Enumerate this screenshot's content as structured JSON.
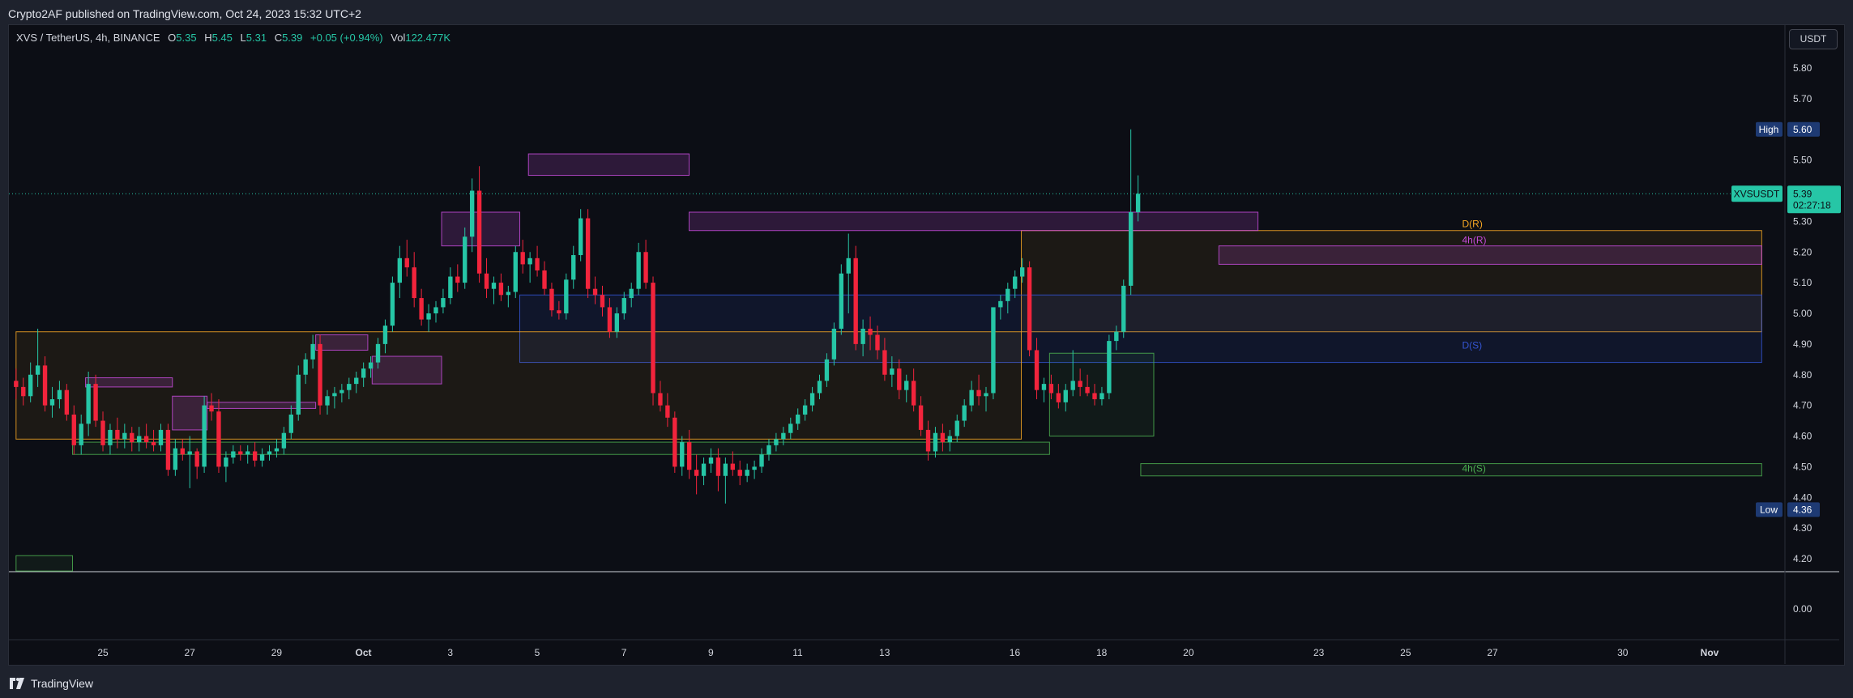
{
  "publisher_line": "Crypto2AF published on TradingView.com, Oct 24, 2023 15:32 UTC+2",
  "legend": {
    "symbol": "XVS / TetherUS, 4h, BINANCE",
    "open_label": "O",
    "open": "5.35",
    "high_label": "H",
    "high": "5.45",
    "low_label": "L",
    "low": "5.31",
    "close_label": "C",
    "close": "5.39",
    "change": "+0.05 (+0.94%)",
    "vol_label": "Vol",
    "vol": "122.477K"
  },
  "currency_button": "USDT",
  "footer_brand": "TradingView",
  "colors": {
    "up": "#26c6a6",
    "down": "#f2243c",
    "resistance_orange": "#f5a623",
    "support_blue": "#3454d1",
    "supply_purple": "#c64bdb",
    "demand_green": "#4caf50",
    "price_tag": "#26c6a6",
    "high_low_tag": "#1e3a73"
  },
  "chart_data": {
    "type": "candlestick",
    "symbol": "XVSUSDT",
    "timeframe": "4h",
    "ylim": [
      4.15,
      5.87
    ],
    "y_ticks": [
      5.8,
      5.7,
      5.6,
      5.5,
      5.4,
      5.3,
      5.2,
      5.1,
      5.0,
      4.9,
      4.8,
      4.7,
      4.6,
      4.5,
      4.4,
      4.3,
      4.2
    ],
    "y_tick_labels": [
      "5.80",
      "5.70",
      "",
      "5.50",
      "",
      "5.30",
      "5.20",
      "5.10",
      "5.00",
      "4.90",
      "4.80",
      "4.70",
      "4.60",
      "4.50",
      "4.40",
      "4.30",
      "4.20"
    ],
    "x_range_days": [
      22.9,
      32.8
    ],
    "x_ticks": [
      {
        "day": 25,
        "label": "25"
      },
      {
        "day": 27,
        "label": "27"
      },
      {
        "day": 29,
        "label": "29"
      },
      {
        "day": 31,
        "label": "Oct"
      },
      {
        "day": 33,
        "label": "3"
      },
      {
        "day": 35,
        "label": "5"
      },
      {
        "day": 37,
        "label": "7"
      },
      {
        "day": 39,
        "label": "9"
      },
      {
        "day": 41,
        "label": "11"
      },
      {
        "day": 43,
        "label": "13"
      },
      {
        "day": 46,
        "label": "16"
      },
      {
        "day": 48,
        "label": "18"
      },
      {
        "day": 50,
        "label": "20"
      },
      {
        "day": 53,
        "label": "23"
      },
      {
        "day": 55,
        "label": "25"
      },
      {
        "day": 57,
        "label": "27"
      },
      {
        "day": 60,
        "label": "30"
      },
      {
        "day": 62,
        "label": "Nov"
      }
    ],
    "candle_start_day": 23.0,
    "candle_step_days": 0.1667,
    "candles": [
      [
        4.78,
        4.82,
        4.72,
        4.76
      ],
      [
        4.76,
        4.79,
        4.7,
        4.73
      ],
      [
        4.73,
        4.84,
        4.71,
        4.8
      ],
      [
        4.8,
        4.95,
        4.76,
        4.83
      ],
      [
        4.83,
        4.86,
        4.68,
        4.7
      ],
      [
        4.7,
        4.76,
        4.66,
        4.72
      ],
      [
        4.72,
        4.78,
        4.69,
        4.75
      ],
      [
        4.75,
        4.77,
        4.65,
        4.67
      ],
      [
        4.67,
        4.7,
        4.54,
        4.57
      ],
      [
        4.57,
        4.67,
        4.54,
        4.64
      ],
      [
        4.64,
        4.81,
        4.6,
        4.77
      ],
      [
        4.77,
        4.8,
        4.63,
        4.65
      ],
      [
        4.65,
        4.68,
        4.55,
        4.57
      ],
      [
        4.57,
        4.64,
        4.54,
        4.62
      ],
      [
        4.62,
        4.66,
        4.56,
        4.59
      ],
      [
        4.59,
        4.64,
        4.56,
        4.61
      ],
      [
        4.61,
        4.63,
        4.55,
        4.58
      ],
      [
        4.58,
        4.63,
        4.55,
        4.6
      ],
      [
        4.6,
        4.64,
        4.56,
        4.58
      ],
      [
        4.58,
        4.62,
        4.55,
        4.57
      ],
      [
        4.57,
        4.64,
        4.55,
        4.62
      ],
      [
        4.62,
        4.64,
        4.47,
        4.49
      ],
      [
        4.49,
        4.59,
        4.47,
        4.56
      ],
      [
        4.56,
        4.59,
        4.52,
        4.54
      ],
      [
        4.54,
        4.6,
        4.43,
        4.55
      ],
      [
        4.55,
        4.56,
        4.46,
        4.5
      ],
      [
        4.5,
        4.73,
        4.48,
        4.7
      ],
      [
        4.7,
        4.74,
        4.65,
        4.68
      ],
      [
        4.68,
        4.72,
        4.48,
        4.5
      ],
      [
        4.5,
        4.55,
        4.45,
        4.53
      ],
      [
        4.53,
        4.57,
        4.51,
        4.55
      ],
      [
        4.55,
        4.57,
        4.52,
        4.54
      ],
      [
        4.54,
        4.57,
        4.51,
        4.55
      ],
      [
        4.55,
        4.58,
        4.5,
        4.52
      ],
      [
        4.52,
        4.56,
        4.5,
        4.54
      ],
      [
        4.54,
        4.57,
        4.52,
        4.55
      ],
      [
        4.55,
        4.59,
        4.53,
        4.56
      ],
      [
        4.56,
        4.63,
        4.54,
        4.61
      ],
      [
        4.61,
        4.7,
        4.59,
        4.67
      ],
      [
        4.67,
        4.83,
        4.65,
        4.8
      ],
      [
        4.8,
        4.87,
        4.77,
        4.85
      ],
      [
        4.85,
        4.93,
        4.82,
        4.9
      ],
      [
        4.9,
        4.93,
        4.67,
        4.7
      ],
      [
        4.7,
        4.75,
        4.67,
        4.73
      ],
      [
        4.73,
        4.76,
        4.69,
        4.74
      ],
      [
        4.74,
        4.77,
        4.71,
        4.75
      ],
      [
        4.75,
        4.79,
        4.72,
        4.77
      ],
      [
        4.77,
        4.81,
        4.74,
        4.79
      ],
      [
        4.79,
        4.84,
        4.76,
        4.82
      ],
      [
        4.82,
        4.86,
        4.79,
        4.84
      ],
      [
        4.84,
        4.92,
        4.82,
        4.9
      ],
      [
        4.9,
        4.98,
        4.87,
        4.96
      ],
      [
        4.96,
        5.12,
        4.94,
        5.1
      ],
      [
        5.1,
        5.22,
        5.05,
        5.18
      ],
      [
        5.18,
        5.24,
        5.12,
        5.15
      ],
      [
        5.15,
        5.2,
        5.02,
        5.05
      ],
      [
        5.05,
        5.08,
        4.96,
        4.98
      ],
      [
        4.98,
        5.03,
        4.94,
        5.0
      ],
      [
        5.0,
        5.04,
        4.97,
        5.02
      ],
      [
        5.02,
        5.08,
        5.0,
        5.05
      ],
      [
        5.05,
        5.15,
        5.03,
        5.12
      ],
      [
        5.12,
        5.16,
        5.07,
        5.1
      ],
      [
        5.1,
        5.28,
        5.08,
        5.25
      ],
      [
        5.25,
        5.44,
        5.2,
        5.4
      ],
      [
        5.4,
        5.48,
        5.1,
        5.13
      ],
      [
        5.13,
        5.18,
        5.05,
        5.08
      ],
      [
        5.08,
        5.12,
        5.03,
        5.1
      ],
      [
        5.1,
        5.13,
        5.04,
        5.06
      ],
      [
        5.06,
        5.09,
        5.02,
        5.07
      ],
      [
        5.07,
        5.22,
        5.05,
        5.2
      ],
      [
        5.2,
        5.24,
        5.13,
        5.16
      ],
      [
        5.16,
        5.2,
        5.1,
        5.18
      ],
      [
        5.18,
        5.22,
        5.12,
        5.14
      ],
      [
        5.14,
        5.17,
        5.06,
        5.08
      ],
      [
        5.08,
        5.1,
        4.99,
        5.01
      ],
      [
        5.01,
        5.04,
        4.98,
        5.0
      ],
      [
        5.0,
        5.13,
        4.98,
        5.11
      ],
      [
        5.11,
        5.22,
        5.08,
        5.19
      ],
      [
        5.19,
        5.34,
        5.17,
        5.31
      ],
      [
        5.31,
        5.34,
        5.05,
        5.08
      ],
      [
        5.08,
        5.12,
        5.03,
        5.06
      ],
      [
        5.06,
        5.09,
        4.99,
        5.02
      ],
      [
        5.02,
        5.05,
        4.92,
        4.94
      ],
      [
        4.94,
        5.02,
        4.92,
        5.0
      ],
      [
        5.0,
        5.07,
        4.98,
        5.05
      ],
      [
        5.05,
        5.1,
        5.02,
        5.08
      ],
      [
        5.08,
        5.23,
        5.06,
        5.2
      ],
      [
        5.2,
        5.24,
        5.08,
        5.1
      ],
      [
        5.1,
        5.12,
        4.7,
        4.74
      ],
      [
        4.74,
        4.78,
        4.68,
        4.7
      ],
      [
        4.7,
        4.74,
        4.63,
        4.66
      ],
      [
        4.66,
        4.68,
        4.48,
        4.5
      ],
      [
        4.5,
        4.6,
        4.47,
        4.58
      ],
      [
        4.58,
        4.62,
        4.46,
        4.49
      ],
      [
        4.49,
        4.54,
        4.41,
        4.47
      ],
      [
        4.47,
        4.53,
        4.44,
        4.51
      ],
      [
        4.51,
        4.56,
        4.48,
        4.53
      ],
      [
        4.53,
        4.56,
        4.42,
        4.47
      ],
      [
        4.47,
        4.53,
        4.38,
        4.51
      ],
      [
        4.51,
        4.55,
        4.47,
        4.49
      ],
      [
        4.49,
        4.52,
        4.44,
        4.47
      ],
      [
        4.47,
        4.51,
        4.45,
        4.49
      ],
      [
        4.49,
        4.52,
        4.46,
        4.5
      ],
      [
        4.5,
        4.56,
        4.48,
        4.54
      ],
      [
        4.54,
        4.59,
        4.52,
        4.57
      ],
      [
        4.57,
        4.61,
        4.55,
        4.59
      ],
      [
        4.59,
        4.63,
        4.57,
        4.61
      ],
      [
        4.61,
        4.66,
        4.59,
        4.64
      ],
      [
        4.64,
        4.69,
        4.62,
        4.67
      ],
      [
        4.67,
        4.72,
        4.65,
        4.7
      ],
      [
        4.7,
        4.76,
        4.68,
        4.74
      ],
      [
        4.74,
        4.8,
        4.72,
        4.78
      ],
      [
        4.78,
        4.87,
        4.76,
        4.85
      ],
      [
        4.85,
        4.97,
        4.83,
        4.95
      ],
      [
        4.95,
        5.16,
        4.93,
        5.13
      ],
      [
        5.13,
        5.26,
        5.0,
        5.18
      ],
      [
        5.18,
        5.22,
        4.88,
        4.9
      ],
      [
        4.9,
        4.98,
        4.86,
        4.95
      ],
      [
        4.95,
        4.99,
        4.88,
        4.93
      ],
      [
        4.93,
        4.96,
        4.85,
        4.88
      ],
      [
        4.88,
        4.92,
        4.78,
        4.8
      ],
      [
        4.8,
        4.86,
        4.76,
        4.82
      ],
      [
        4.82,
        4.85,
        4.72,
        4.75
      ],
      [
        4.75,
        4.8,
        4.71,
        4.78
      ],
      [
        4.78,
        4.82,
        4.68,
        4.7
      ],
      [
        4.7,
        4.73,
        4.6,
        4.62
      ],
      [
        4.62,
        4.65,
        4.52,
        4.55
      ],
      [
        4.55,
        4.63,
        4.53,
        4.61
      ],
      [
        4.61,
        4.64,
        4.55,
        4.58
      ],
      [
        4.58,
        4.62,
        4.55,
        4.6
      ],
      [
        4.6,
        4.67,
        4.58,
        4.65
      ],
      [
        4.65,
        4.72,
        4.63,
        4.7
      ],
      [
        4.7,
        4.78,
        4.68,
        4.75
      ],
      [
        4.75,
        4.8,
        4.7,
        4.73
      ],
      [
        4.73,
        4.76,
        4.68,
        4.74
      ],
      [
        4.74,
        4.98,
        4.72,
        5.02
      ],
      [
        5.02,
        5.06,
        4.98,
        5.04
      ],
      [
        5.04,
        5.1,
        5.0,
        5.08
      ],
      [
        5.08,
        5.14,
        5.05,
        5.12
      ],
      [
        5.12,
        5.18,
        5.1,
        5.15
      ],
      [
        5.15,
        5.17,
        4.86,
        4.88
      ],
      [
        4.88,
        4.92,
        4.72,
        4.75
      ],
      [
        4.75,
        4.79,
        4.71,
        4.77
      ],
      [
        4.77,
        4.8,
        4.72,
        4.74
      ],
      [
        4.74,
        4.77,
        4.69,
        4.71
      ],
      [
        4.71,
        4.77,
        4.68,
        4.75
      ],
      [
        4.75,
        4.88,
        4.73,
        4.78
      ],
      [
        4.78,
        4.82,
        4.73,
        4.76
      ],
      [
        4.76,
        4.8,
        4.73,
        4.74
      ],
      [
        4.74,
        4.77,
        4.7,
        4.72
      ],
      [
        4.72,
        4.76,
        4.7,
        4.74
      ],
      [
        4.74,
        4.93,
        4.72,
        4.91
      ],
      [
        4.91,
        4.96,
        4.88,
        4.94
      ],
      [
        4.94,
        5.11,
        4.92,
        5.09
      ],
      [
        5.09,
        5.6,
        5.06,
        5.33
      ],
      [
        5.33,
        5.45,
        5.3,
        5.39
      ]
    ],
    "zones": [
      {
        "name": "D(R)",
        "kind": "resistance",
        "color": "#f5a623",
        "y_top": 5.27,
        "y_bottom": 4.94,
        "x0": 46.15,
        "x1": 63.2,
        "label_x": 56.3
      },
      {
        "name": "4h(R)",
        "kind": "supply",
        "color": "#c64bdb",
        "y_top": 5.22,
        "y_bottom": 5.16,
        "x0": 50.7,
        "x1": 63.2,
        "label_x": 56.3
      },
      {
        "name": "D(S)",
        "kind": "support",
        "color": "#3454d1",
        "y_top": 5.06,
        "y_bottom": 4.84,
        "x0": 34.6,
        "x1": 63.2,
        "label_x": 56.3
      },
      {
        "name": "4h(S)",
        "kind": "demand",
        "color": "#4caf50",
        "y_top": 4.51,
        "y_bottom": 4.47,
        "x0": 48.9,
        "x1": 63.2,
        "label_x": 56.3
      },
      {
        "name": "",
        "kind": "resistance",
        "color": "#f5a623",
        "y_top": 4.94,
        "y_bottom": 4.59,
        "x0": 23.0,
        "x1": 46.15,
        "label_x": 0
      },
      {
        "name": "",
        "kind": "demand",
        "color": "#4caf50",
        "y_top": 4.58,
        "y_bottom": 4.54,
        "x0": 24.3,
        "x1": 46.8,
        "label_x": 0
      },
      {
        "name": "",
        "kind": "demand",
        "color": "#4caf50",
        "y_top": 4.87,
        "y_bottom": 4.6,
        "x0": 46.8,
        "x1": 49.2,
        "label_x": 0
      },
      {
        "name": "",
        "kind": "supply",
        "color": "#c64bdb",
        "y_top": 5.52,
        "y_bottom": 5.45,
        "x0": 34.8,
        "x1": 38.5,
        "label_x": 0
      },
      {
        "name": "",
        "kind": "supply",
        "color": "#c64bdb",
        "y_top": 5.33,
        "y_bottom": 5.27,
        "x0": 38.5,
        "x1": 51.6,
        "label_x": 0
      },
      {
        "name": "",
        "kind": "supply",
        "color": "#c64bdb",
        "y_top": 5.33,
        "y_bottom": 5.22,
        "x0": 32.8,
        "x1": 34.6,
        "label_x": 0
      },
      {
        "name": "",
        "kind": "supply",
        "color": "#c64bdb",
        "y_top": 4.93,
        "y_bottom": 4.88,
        "x0": 29.9,
        "x1": 31.1,
        "label_x": 0
      },
      {
        "name": "",
        "kind": "supply",
        "color": "#c64bdb",
        "y_top": 4.86,
        "y_bottom": 4.77,
        "x0": 31.2,
        "x1": 32.8,
        "label_x": 0
      },
      {
        "name": "",
        "kind": "supply",
        "color": "#c64bdb",
        "y_top": 4.79,
        "y_bottom": 4.76,
        "x0": 24.6,
        "x1": 26.6,
        "label_x": 0
      },
      {
        "name": "",
        "kind": "supply",
        "color": "#c64bdb",
        "y_top": 4.73,
        "y_bottom": 4.62,
        "x0": 26.6,
        "x1": 27.4,
        "label_x": 0
      },
      {
        "name": "",
        "kind": "supply",
        "color": "#c64bdb",
        "y_top": 4.71,
        "y_bottom": 4.69,
        "x0": 27.4,
        "x1": 29.9,
        "label_x": 0
      },
      {
        "name": "",
        "kind": "demand",
        "color": "#4caf50",
        "y_top": 4.21,
        "y_bottom": 4.16,
        "x0": 23.0,
        "x1": 24.3,
        "label_x": 0
      }
    ],
    "current_price": {
      "label": "XVSUSDT",
      "value": "5.39",
      "countdown": "02:27:18",
      "price": 5.39
    },
    "high_marker": {
      "label": "High",
      "value": "5.60",
      "price": 5.6
    },
    "low_marker": {
      "label": "Low",
      "value": "4.36",
      "price": 4.36
    },
    "indicator_pane": {
      "y_tick_label": "0.00"
    }
  }
}
